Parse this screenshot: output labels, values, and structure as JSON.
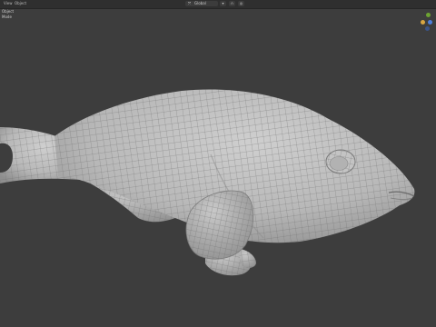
{
  "header": {
    "menu": [
      "View",
      "Object"
    ],
    "mode_label": "Object Mode",
    "transform_orientation": "Global",
    "transform_icon": "orientation-icon",
    "chevron_icon": "chevron-down-icon",
    "snap_icon": "magnet-icon",
    "proportional_icon": "proportional-edit-icon"
  },
  "navigation_gizmo": {
    "axes": [
      "X",
      "Y",
      "Z"
    ],
    "colors": {
      "x": "#d8a642",
      "y": "#6da332",
      "z": "#4e7fdc"
    }
  },
  "viewport": {
    "background": "#3d3d3d",
    "object": "fish-mesh",
    "shading": "solid-wireframe",
    "mesh_color": "#b9b9b9",
    "wire_color": "#6f6f6f"
  }
}
